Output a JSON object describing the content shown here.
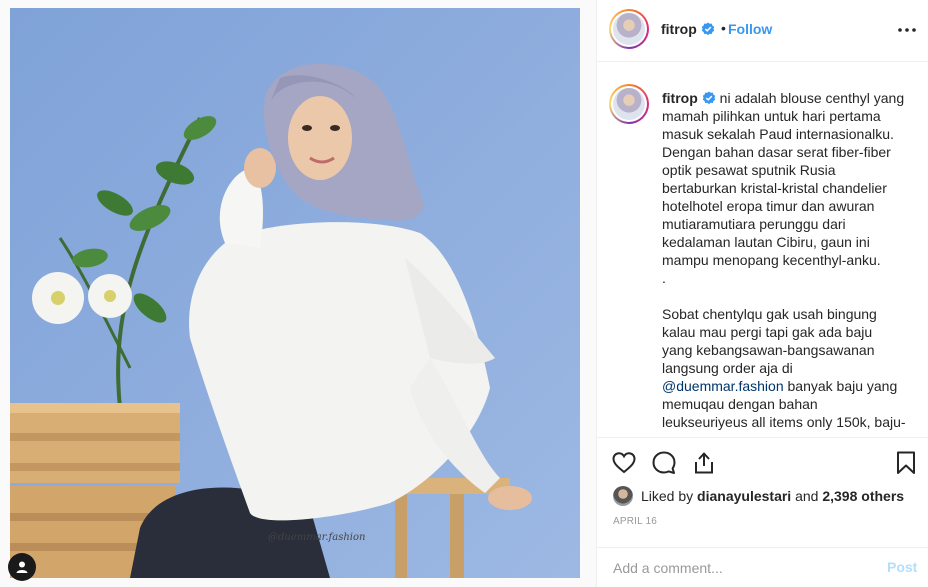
{
  "post": {
    "username": "fitrop",
    "follow_label": "Follow",
    "dot": "•",
    "caption_lines": [
      "ni adalah blouse centhyl yang",
      "mamah pilihkan untuk hari pertama",
      "masuk sekalah Paud internasionalku.",
      "Dengan bahan dasar serat fiber-fiber",
      "optik pesawat sputnik Rusia",
      "bertaburkan kristal-kristal chandelier",
      "hotelhotel eropa timur dan awuran",
      "mutiaramutiara perunggu dari",
      "kedalaman lautan Cibiru, gaun ini",
      "mampu menopang kecenthyl-anku.",
      ".",
      "",
      "Sobat chentylqu gak usah bingung",
      "kalau mau pergi tapi gak ada baju",
      "yang kebangsawan-bangsawanan",
      "langsung order aja di"
    ],
    "mention": "@duemmar.fashion",
    "caption_after_mention": " banyak baju yang",
    "caption_tail_lines": [
      "memuqau dengan bahan",
      "leukseuriyeus all items only 150k, baju-"
    ],
    "liked_prefix": "Liked by",
    "liked_user": "dianayulestari",
    "liked_and": "and",
    "liked_count": "2,398 others",
    "date": "APRIL 16",
    "comment_placeholder": "Add a comment...",
    "post_label": "Post",
    "photo_watermark": "@duemmar.fashion"
  },
  "icons": {
    "verified": "verified-badge-icon",
    "more": "more-options-icon",
    "like": "heart-icon",
    "comment": "comment-bubble-icon",
    "share": "share-icon",
    "save": "bookmark-icon",
    "user_tag": "user-tag-icon"
  },
  "colors": {
    "accent": "#3897f0",
    "mention": "#003569",
    "muted": "#999999",
    "post_disabled": "#b2dffc",
    "photo_bg": "#8faedb"
  }
}
